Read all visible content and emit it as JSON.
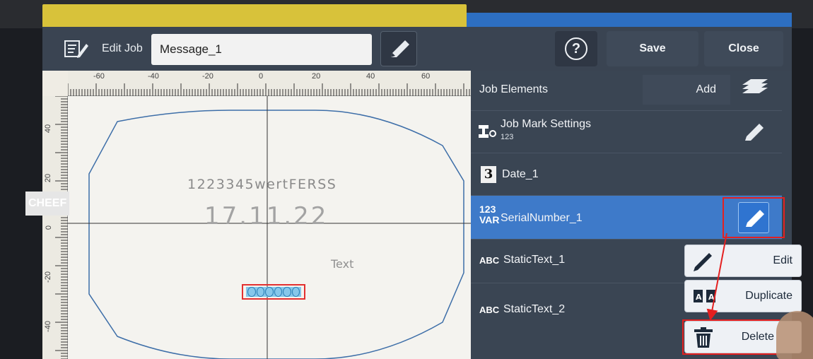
{
  "header": {
    "edit_job_label": "Edit Job",
    "job_name": "Message_1",
    "help_symbol": "?",
    "save_label": "Save",
    "close_label": "Close"
  },
  "ruler": {
    "top_ticks": [
      "-60",
      "-40",
      "-20",
      "0",
      "20",
      "40",
      "60"
    ],
    "left_ticks": [
      "40",
      "20",
      "0",
      "-20",
      "-40"
    ]
  },
  "canvas": {
    "field_text": "1223345wertFERSS",
    "field_date": "17.11.22",
    "field_static": "Text",
    "serial_digits": 6
  },
  "watermark_text": "CHEEF",
  "panel": {
    "title": "Job Elements",
    "add_label": "Add",
    "items": [
      {
        "name": "Job Mark Settings",
        "sub": "123",
        "badge": "job-mark-icon"
      },
      {
        "name": "Date_1",
        "badge": "3"
      },
      {
        "name": "SerialNumber_1",
        "badge_top": "123",
        "badge_bottom": "VAR",
        "selected": true
      },
      {
        "name": "StaticText_1",
        "badge": "ABC"
      },
      {
        "name": "StaticText_2",
        "badge": "ABC"
      }
    ]
  },
  "context_menu": {
    "edit_label": "Edit",
    "duplicate_label": "Duplicate",
    "delete_label": "Delete"
  },
  "colors": {
    "accent_blue": "#3e7ac9",
    "highlight_red": "#e42020",
    "panel_bg": "#3a4553"
  },
  "icons": [
    "edit-job-icon",
    "pencil-icon",
    "help-icon",
    "layers-icon",
    "job-mark-icon",
    "trash-icon",
    "duplicate-icon"
  ]
}
